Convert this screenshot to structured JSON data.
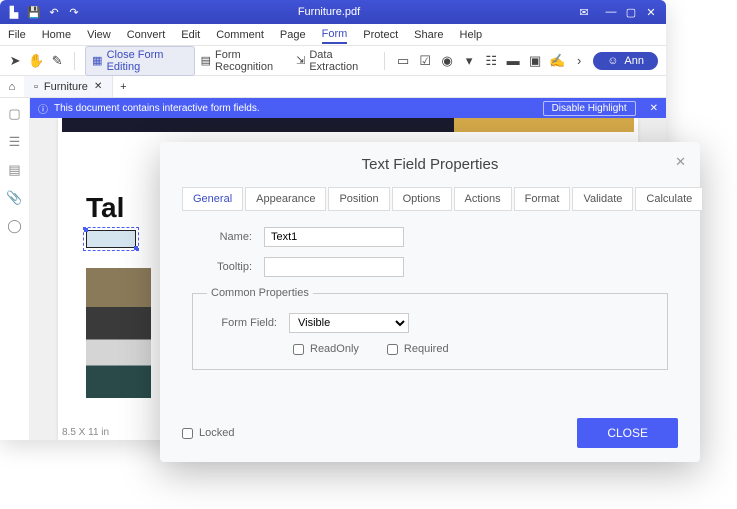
{
  "titlebar": {
    "title": "Furniture.pdf"
  },
  "menu": {
    "items": [
      "File",
      "Home",
      "View",
      "Convert",
      "Edit",
      "Comment",
      "Page",
      "Form",
      "Protect",
      "Share",
      "Help"
    ],
    "active": "Form"
  },
  "toolbar": {
    "close_form_editing": "Close Form Editing",
    "form_recognition": "Form Recognition",
    "data_extraction": "Data Extraction",
    "user": "Ann"
  },
  "filetab": {
    "name": "Furniture"
  },
  "banner": {
    "text": "This document contains interactive form fields.",
    "button": "Disable Highlight"
  },
  "page": {
    "heading": "Tal",
    "status": "8.5 X 11 in"
  },
  "dialog": {
    "title": "Text Field Properties",
    "tabs": [
      "General",
      "Appearance",
      "Position",
      "Options",
      "Actions",
      "Format",
      "Validate",
      "Calculate"
    ],
    "active_tab": "General",
    "name_label": "Name:",
    "name_value": "Text1",
    "tooltip_label": "Tooltip:",
    "tooltip_value": "",
    "common_legend": "Common Properties",
    "formfield_label": "Form Field:",
    "formfield_value": "Visible",
    "readonly_label": "ReadOnly",
    "required_label": "Required",
    "locked_label": "Locked",
    "close_btn": "CLOSE"
  }
}
